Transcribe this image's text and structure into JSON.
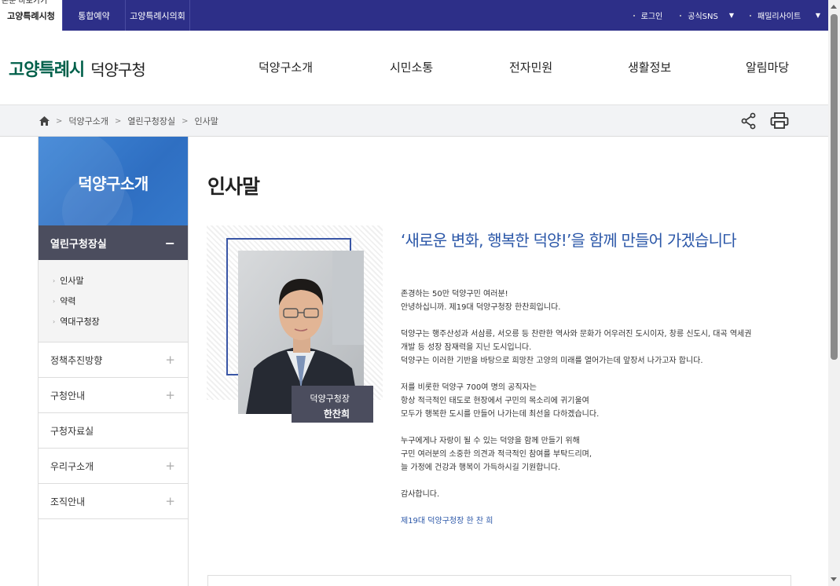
{
  "topbar": {
    "skip_link": "본문 바로가기",
    "site_tabs": [
      "고양특례시청",
      "통합예약",
      "고양특례시의회"
    ],
    "login": "로그인",
    "sns": "공식SNS",
    "family": "패밀리사이트"
  },
  "header": {
    "logo_main": "고양특례시",
    "logo_sub": "덕양구청",
    "gnb": [
      "덕양구소개",
      "시민소통",
      "전자민원",
      "생활정보",
      "알림마당"
    ]
  },
  "breadcrumb": [
    "덕양구소개",
    "열린구청장실",
    "인사말"
  ],
  "lnb": {
    "title": "덕양구소개",
    "active": "열린구청장실",
    "sub_items": [
      "인사말",
      "약력",
      "역대구청장"
    ],
    "items": [
      "정책추진방향",
      "구청안내",
      "구청자료실",
      "우리구소개",
      "조직안내"
    ]
  },
  "content": {
    "title": "인사말",
    "caption_role": "덕양구청장",
    "caption_name": "한찬희",
    "headline": "‘새로운 변화, 행복한 덕양!’을 함께 만들어 가겠습니다",
    "p1": [
      "존경하는 50만 덕양구민 여러분!",
      "안녕하십니까. 제19대 덕양구청장 한찬희입니다."
    ],
    "p2": [
      "덕양구는 행주산성과 서삼릉, 서오릉 등 찬란한 역사와 문화가 어우러진 도시이자, 창릉 신도시, 대곡 역세권",
      "개발 등 성장 잠재력을 지닌 도시입니다.",
      "덕양구는 이러한 기반을 바탕으로 희망찬 고양의 미래를 열어가는데 앞장서 나가고자 합니다."
    ],
    "p3": [
      "저를 비롯한 덕양구 700여 명의 공직자는",
      "항상 적극적인 태도로 현장에서 구민의 목소리에 귀기울여",
      "모두가 행복한 도시를 만들어 나가는데 최선을 다하겠습니다."
    ],
    "p4": [
      "누구에게나 자랑이 될 수 있는 덕양을 함께 만들기 위해",
      "구민 여러분의 소중한 의견과 적극적인 참여를 부탁드리며,",
      "늘 가정에 건강과 행복이 가득하시길 기원합니다."
    ],
    "p5": "감사합니다.",
    "sign": "제19대 덕양구청장 한 찬 희"
  },
  "colors": {
    "topbar": "#2d2f88",
    "logo": "#00604a",
    "accent": "#2b57a8",
    "lnb_active": "#4b4d5e"
  }
}
